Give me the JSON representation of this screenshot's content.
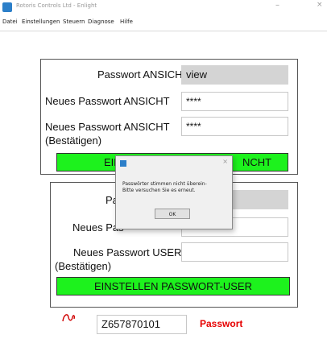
{
  "window": {
    "title": "Rotoris Controls Ltd - Enlight",
    "minimize": "–",
    "close": "×"
  },
  "menu": [
    "Datei",
    "Einstellungen",
    "Steuern",
    "Diagnose",
    "Hilfe"
  ],
  "panel_view": {
    "current_label": "Passwort ANSICHT",
    "current_value": "view",
    "new_label": "Neues Passwort ANSICHT",
    "new_value": "****",
    "confirm_label": "Neues Passwort ANSICHT",
    "confirm_label_2": "(Bestätigen)",
    "confirm_value": "****",
    "button_left": "EINST",
    "button_right": "NCHT"
  },
  "panel_user": {
    "current_label": "Pa",
    "new_label": "Neues Pas",
    "confirm_label": "Neues Passwort USER",
    "confirm_label_2": "(Bestätigen)",
    "button": "EINSTELLEN PASSWORT-USER"
  },
  "dialog": {
    "message_line1": "Passwörter stimmen nicht überein-",
    "message_line2": "Bitte versuchen Sie es erneut.",
    "ok": "OK",
    "close": "×"
  },
  "footer": {
    "logo_icon": "signature-logo-icon",
    "serial": "Z657870101",
    "password_link": "Passwort",
    "link_color": "#e60000"
  },
  "colors": {
    "button_green": "#1df21d",
    "readonly_field": "#d4d4d4"
  }
}
